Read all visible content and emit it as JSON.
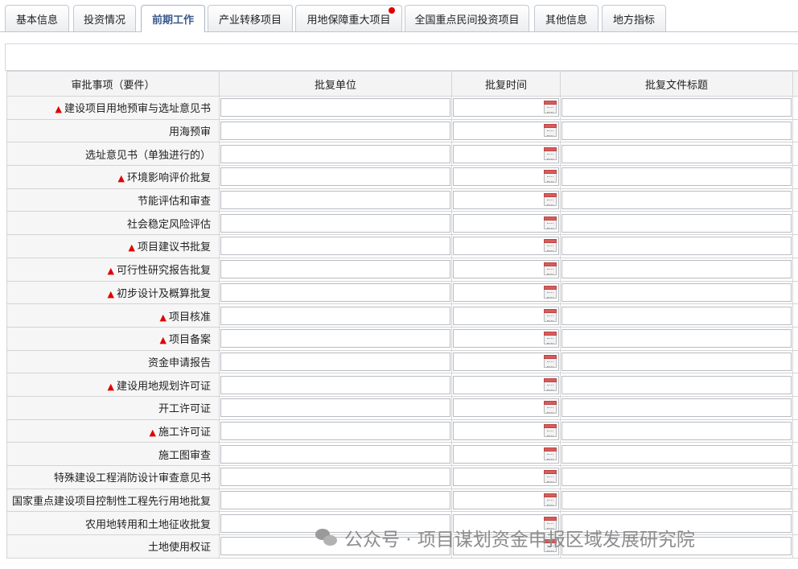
{
  "tabs": [
    {
      "label": "基本信息",
      "active": false,
      "dot": false
    },
    {
      "label": "投资情况",
      "active": false,
      "dot": false
    },
    {
      "label": "前期工作",
      "active": true,
      "dot": false
    },
    {
      "label": "产业转移项目",
      "active": false,
      "dot": false
    },
    {
      "label": "用地保障重大项目",
      "active": false,
      "dot": true
    },
    {
      "label": "全国重点民间投资项目",
      "active": false,
      "dot": false
    },
    {
      "label": "其他信息",
      "active": false,
      "dot": false
    },
    {
      "label": "地方指标",
      "active": false,
      "dot": false
    }
  ],
  "table": {
    "headers": [
      "审批事项（要件）",
      "批复单位",
      "批复时间",
      "批复文件标题"
    ],
    "rows": [
      {
        "label": "建设项目用地预审与选址意见书",
        "required": true
      },
      {
        "label": "用海预审",
        "required": false
      },
      {
        "label": "选址意见书（单独进行的）",
        "required": false
      },
      {
        "label": "环境影响评价批复",
        "required": true
      },
      {
        "label": "节能评估和审查",
        "required": false
      },
      {
        "label": "社会稳定风险评估",
        "required": false
      },
      {
        "label": "项目建议书批复",
        "required": true
      },
      {
        "label": "可行性研究报告批复",
        "required": true
      },
      {
        "label": "初步设计及概算批复",
        "required": true
      },
      {
        "label": "项目核准",
        "required": true
      },
      {
        "label": "项目备案",
        "required": true
      },
      {
        "label": "资金申请报告",
        "required": false
      },
      {
        "label": "建设用地规划许可证",
        "required": true
      },
      {
        "label": "开工许可证",
        "required": false
      },
      {
        "label": "施工许可证",
        "required": true
      },
      {
        "label": "施工图审查",
        "required": false
      },
      {
        "label": "特殊建设工程消防设计审查意见书",
        "required": false
      },
      {
        "label": "国家重点建设项目控制性工程先行用地批复",
        "required": false
      },
      {
        "label": "农用地转用和土地征收批复",
        "required": false
      },
      {
        "label": "土地使用权证",
        "required": false
      }
    ],
    "required_marker": "▲",
    "required_color": "#e00000",
    "calendar_icon": "calendar-icon"
  },
  "watermark": {
    "text": "公众号 · 项目谋划资金申报区域发展研究院",
    "icon": "wechat-icon"
  }
}
